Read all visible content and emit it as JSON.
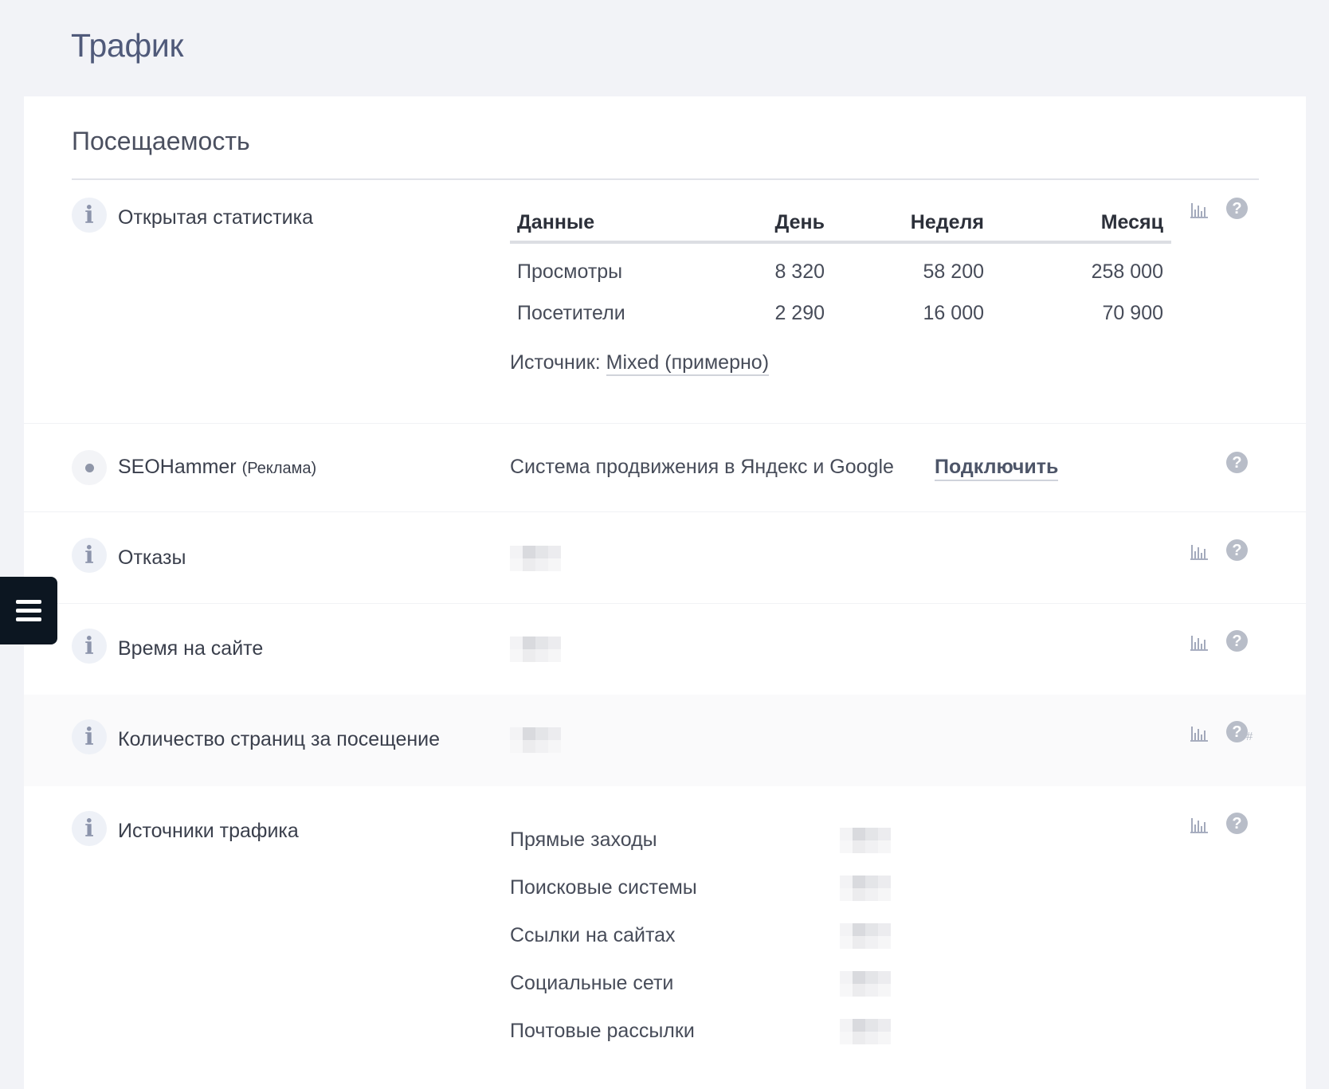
{
  "page": {
    "title": "Трафик"
  },
  "section": {
    "title": "Посещаемость"
  },
  "open_stats": {
    "label": "Открытая статистика",
    "headers": [
      "Данные",
      "День",
      "Неделя",
      "Месяц"
    ],
    "rows": [
      [
        "Просмотры",
        "8 320",
        "58 200",
        "258 000"
      ],
      [
        "Посетители",
        "2 290",
        "16 000",
        "70 900"
      ]
    ],
    "source_label": "Источник:",
    "source_value": "Mixed (примерно)"
  },
  "seohammer": {
    "label": "SEOHammer",
    "tag": "(Реклама)",
    "description": "Система продвижения в Яндекс и Google",
    "action": "Подключить"
  },
  "bounces": {
    "label": "Отказы"
  },
  "time_on_site": {
    "label": "Время на сайте"
  },
  "pages_per_visit": {
    "label": "Количество страниц за посещение",
    "hash": "#"
  },
  "traffic_sources": {
    "label": "Источники трафика",
    "items": [
      "Прямые заходы",
      "Поисковые системы",
      "Ссылки на сайтах",
      "Социальные сети",
      "Почтовые рассылки"
    ]
  },
  "icons": {
    "info": "i",
    "help": "?",
    "chart": "bar-chart-icon",
    "menu": "hamburger-menu-icon"
  },
  "colors": {
    "menu_tab": "#0c1621",
    "help": "#b8bdc8",
    "info_bg": "#eef1f7"
  }
}
